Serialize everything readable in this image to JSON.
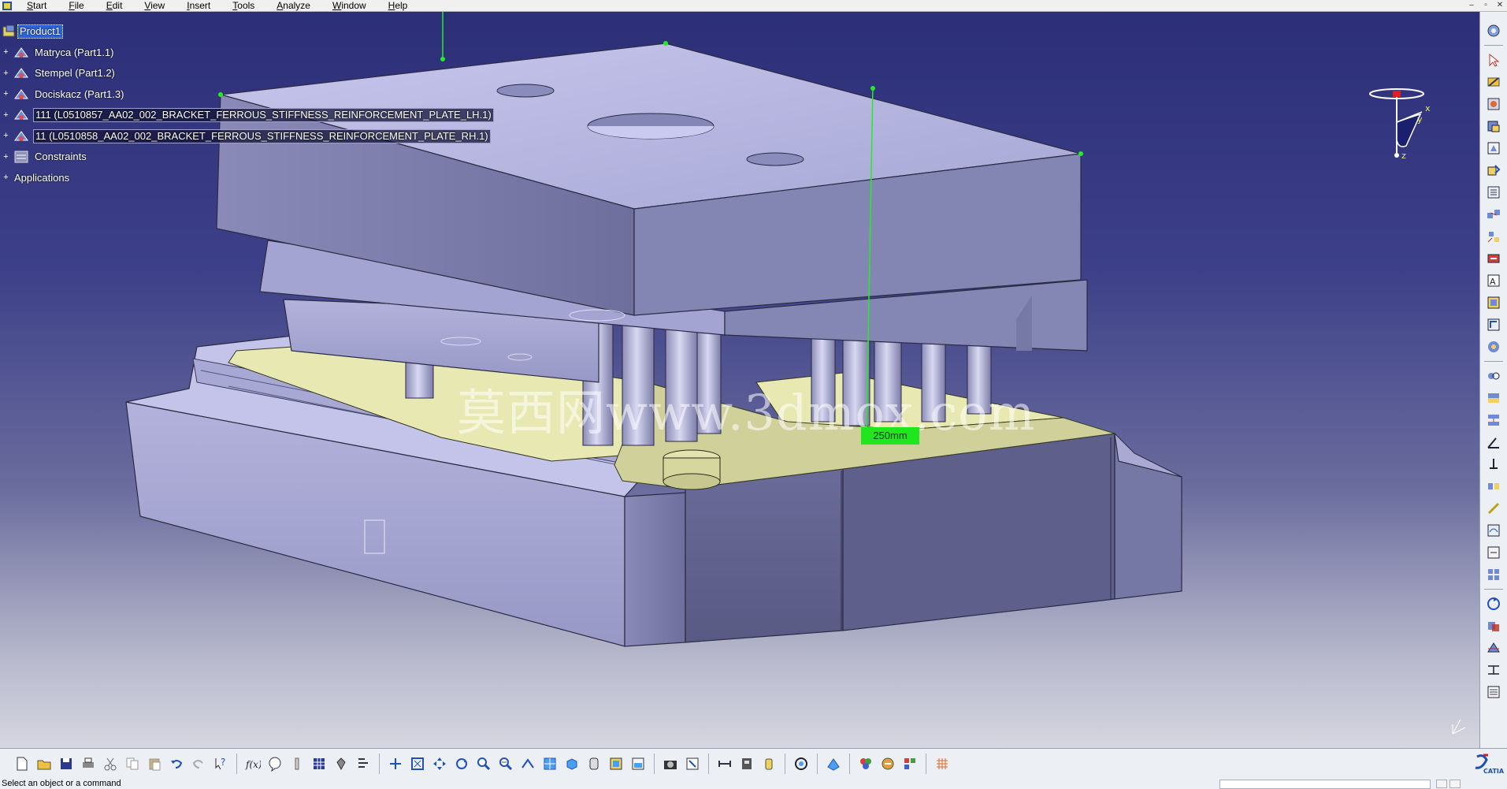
{
  "menubar": {
    "items": [
      "Start",
      "File",
      "Edit",
      "View",
      "Insert",
      "Tools",
      "Analyze",
      "Window",
      "Help"
    ]
  },
  "window_controls": [
    "minimize-icon",
    "restore-icon",
    "close-icon"
  ],
  "spec_tree": {
    "root": "Product1",
    "items": [
      {
        "label": "Matryca (Part1.1)",
        "icon": "part-icon"
      },
      {
        "label": "Stempel (Part1.2)",
        "icon": "part-icon"
      },
      {
        "label": "Dociskacz (Part1.3)",
        "icon": "part-icon"
      },
      {
        "label": "111 (L0510857_AA02_002_BRACKET_FERROUS_STIFFNESS_REINFORCEMENT_PLATE_LH.1)",
        "icon": "part-icon"
      },
      {
        "label": "11 (L0510858_AA02_002_BRACKET_FERROUS_STIFFNESS_REINFORCEMENT_PLATE_RH.1)",
        "icon": "part-icon"
      },
      {
        "label": "Constraints",
        "icon": "constraints-icon"
      }
    ],
    "applications": "Applications"
  },
  "viewport": {
    "dimension_label": "250mm",
    "watermark": "莫西网www.3dmox.com",
    "compass_axes": {
      "x": "x",
      "y": "y",
      "z": "z"
    }
  },
  "right_toolbar": {
    "icons": [
      "rotate-view-icon",
      "select-arrow-icon",
      "manipulate-icon",
      "catalog-icon",
      "existing-component-icon",
      "new-part-icon",
      "replace-component-icon",
      "reorder-icon",
      "multi-instantiation-icon",
      "explode-icon",
      "stop-manipulate-icon",
      "snap-icon",
      "smart-move-icon",
      "fix-component-icon",
      "scene-icon",
      "coincidence-constraint-icon",
      "contact-constraint-icon",
      "offset-constraint-icon",
      "angle-constraint-icon",
      "fix-constraint-icon",
      "fix-together-icon",
      "quick-constraint-icon",
      "flexible-icon",
      "change-constraint-icon",
      "reuse-pattern-icon",
      "update-icon",
      "clash-icon",
      "sectioning-icon",
      "measure-icon",
      "bill-of-material-icon"
    ]
  },
  "bottom_toolbar": {
    "groups": [
      [
        "new-icon",
        "open-icon",
        "save-icon",
        "print-icon",
        "cut-icon",
        "copy-icon",
        "paste-icon",
        "undo-icon",
        "redo-icon",
        "whats-this-icon"
      ],
      [
        "formula-icon",
        "knowledge-icon",
        "parameter-icon",
        "design-table-icon",
        "knowledge-advisor-icon",
        "law-icon"
      ],
      [
        "fly-mode-icon",
        "fit-all-icon",
        "pan-icon",
        "rotate-icon",
        "zoom-in-icon",
        "zoom-out-icon",
        "normal-view-icon",
        "multi-view-icon",
        "iso-view-icon",
        "hide-show-icon",
        "swap-space-icon",
        "render-style-icon"
      ],
      [
        "capture-icon",
        "catalog-browser-icon"
      ],
      [
        "distance-icon",
        "measure-item-icon",
        "inertia-icon"
      ],
      [
        "update-all-icon"
      ],
      [
        "publication-icon"
      ],
      [
        "material-icon",
        "apply-material-icon",
        "analysis-icon"
      ],
      [
        "grid-icon"
      ]
    ],
    "logo": "catia-logo"
  },
  "statusbar": {
    "message": "Select an object or a command"
  },
  "colors": {
    "viewport_top": "#2c2f78",
    "viewport_bottom": "#d6d6e0",
    "part_face": "#b4b4e0",
    "part_side": "#7f7fae",
    "part_dark": "#5f608a",
    "sheet_metal": "#e6e8b0",
    "dimension": "#1fe61f",
    "selection": "#2d63d8"
  }
}
